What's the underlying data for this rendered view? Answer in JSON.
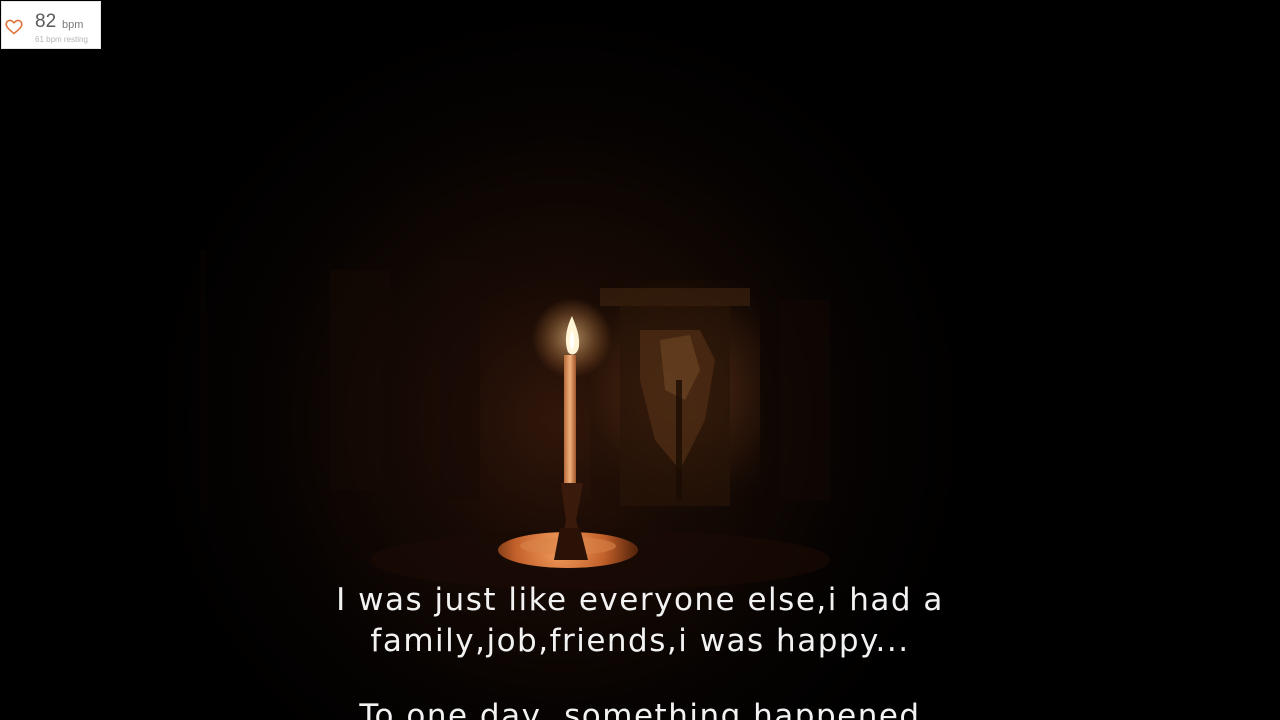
{
  "heart_rate": {
    "value": "82",
    "unit": "bpm",
    "resting": "61 bpm resting",
    "icon": "heart-outline-icon",
    "accent_color": "#e0753c"
  },
  "subtitles": {
    "line1": "I was just like everyone else,i had a",
    "line2": "family,job,friends,i was happy...",
    "line3_partial": "To one day, something happened"
  },
  "scene": {
    "description_colors": {
      "flame": "#fff4d6",
      "candle": "#e6a068",
      "holder": "#c0622e",
      "background": "#000000"
    }
  }
}
